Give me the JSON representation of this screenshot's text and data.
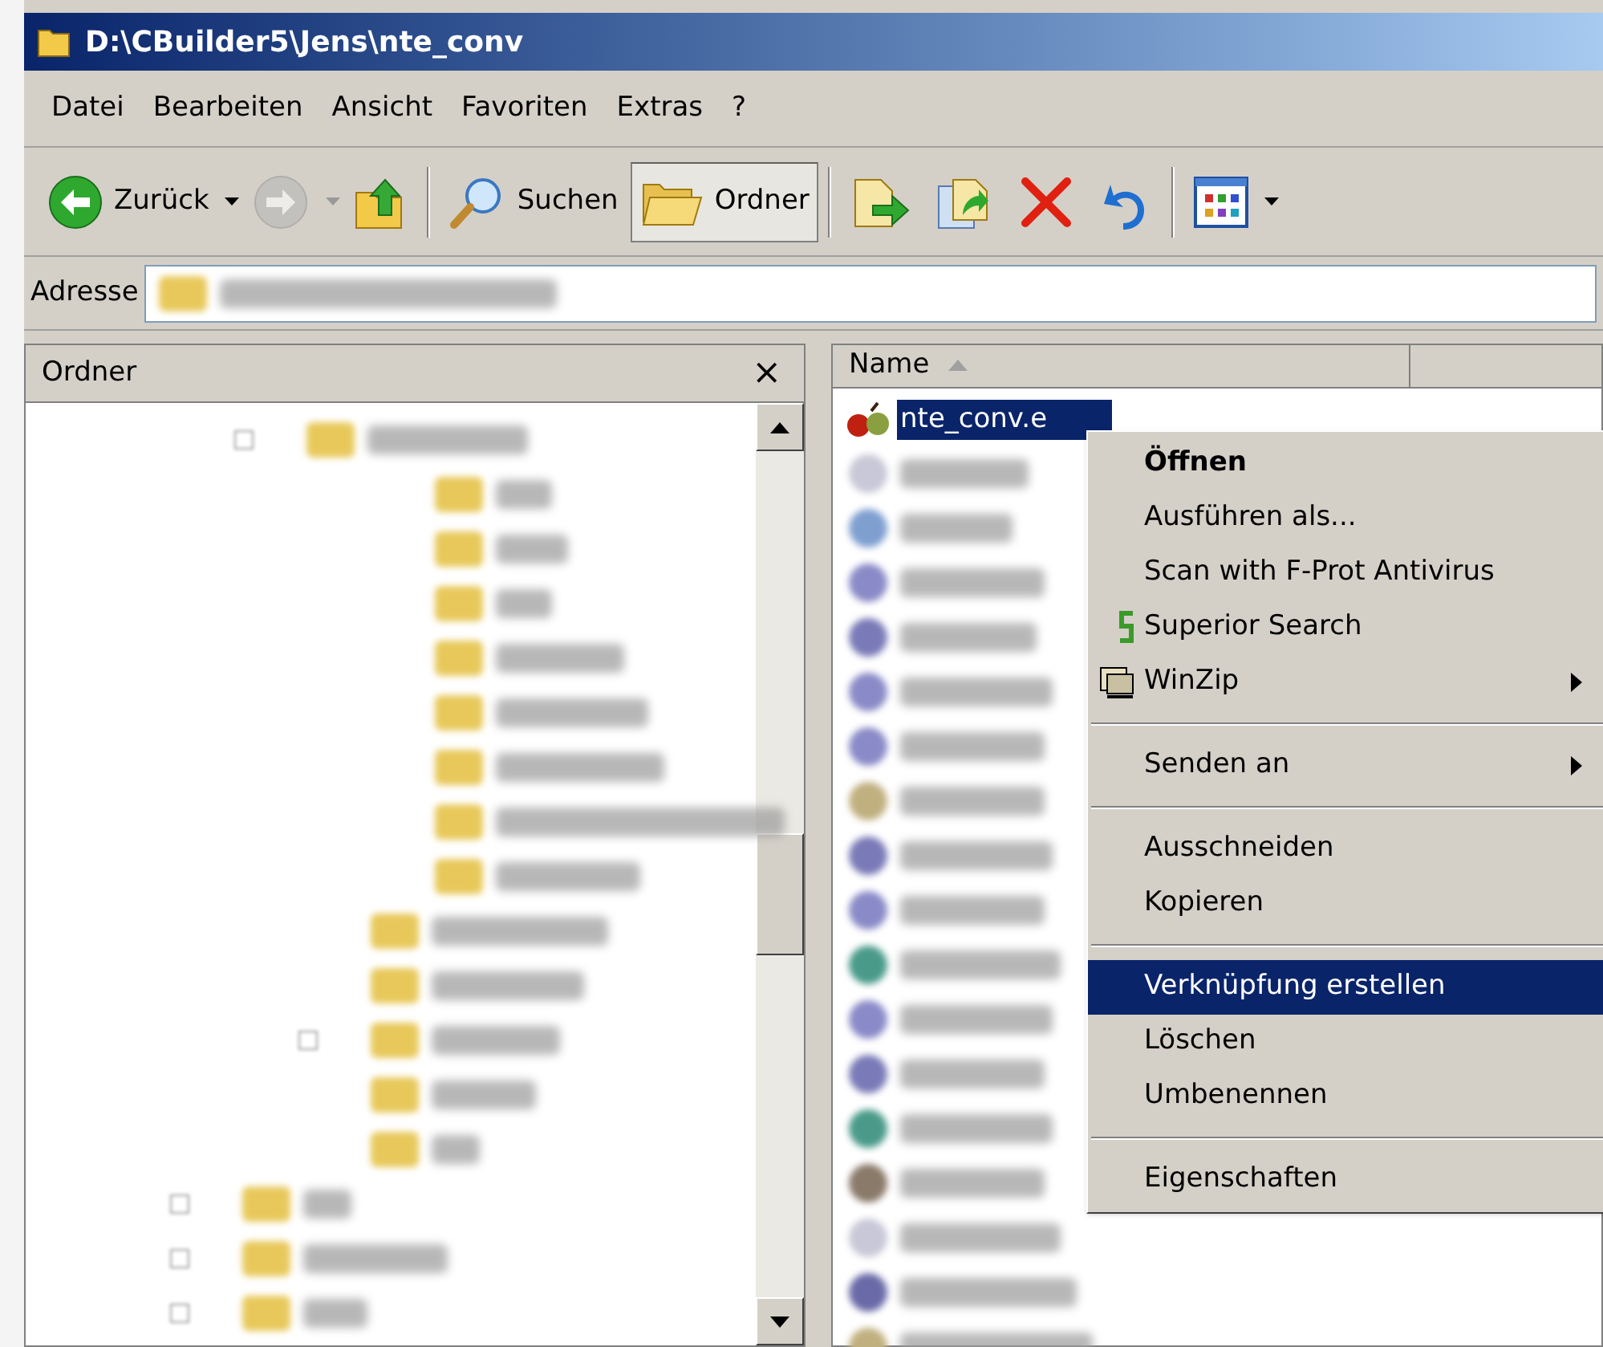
{
  "window": {
    "title": "D:\\CBuilder5\\Jens\\nte_conv"
  },
  "menu_bar": [
    "Datei",
    "Bearbeiten",
    "Ansicht",
    "Favoriten",
    "Extras",
    "?"
  ],
  "toolbar": [
    {
      "kind": "button",
      "label": "Zurück",
      "dropdown": true,
      "disabled": false,
      "selected": false
    },
    {
      "kind": "button",
      "dropdown": true,
      "disabled": true,
      "selected": false
    },
    {
      "kind": "button",
      "dropdown": false,
      "disabled": false,
      "selected": false
    },
    {
      "kind": "separator"
    },
    {
      "kind": "button",
      "label": "Suchen",
      "dropdown": false,
      "disabled": false,
      "selected": false
    },
    {
      "kind": "button",
      "label": "Ordner",
      "dropdown": false,
      "disabled": false,
      "selected": true
    },
    {
      "kind": "separator"
    },
    {
      "kind": "button",
      "dropdown": false,
      "disabled": false,
      "selected": false
    },
    {
      "kind": "button",
      "dropdown": false,
      "disabled": false,
      "selected": false
    },
    {
      "kind": "button",
      "dropdown": false,
      "disabled": false,
      "selected": false
    },
    {
      "kind": "button",
      "dropdown": false,
      "disabled": false,
      "selected": false
    },
    {
      "kind": "separator"
    },
    {
      "kind": "button",
      "dropdown": true,
      "disabled": false,
      "selected": false
    }
  ],
  "address_bar": {
    "label": "Adresse"
  },
  "folder_pane": {
    "title": "Ordner",
    "close": "×"
  },
  "file_list": {
    "columns": [
      {
        "label": "Name",
        "sorted": true
      }
    ],
    "rows": [
      {
        "name": "nte_conv.e",
        "selected": true
      }
    ]
  },
  "context_menu": [
    {
      "kind": "item",
      "label": "Öffnen",
      "default": true,
      "submenu": false,
      "selected": false
    },
    {
      "kind": "item",
      "label": "Ausführen als...",
      "default": false,
      "submenu": false,
      "selected": false
    },
    {
      "kind": "item",
      "label": "Scan with F-Prot Antivirus",
      "default": false,
      "submenu": false,
      "selected": false
    },
    {
      "kind": "item",
      "label": "Superior Search",
      "default": false,
      "submenu": false,
      "selected": false
    },
    {
      "kind": "item",
      "label": "WinZip",
      "default": false,
      "submenu": true,
      "selected": false
    },
    {
      "kind": "separator"
    },
    {
      "kind": "item",
      "label": "Senden an",
      "default": false,
      "submenu": true,
      "selected": false
    },
    {
      "kind": "separator"
    },
    {
      "kind": "item",
      "label": "Ausschneiden",
      "default": false,
      "submenu": false,
      "selected": false
    },
    {
      "kind": "item",
      "label": "Kopieren",
      "default": false,
      "submenu": false,
      "selected": false
    },
    {
      "kind": "separator"
    },
    {
      "kind": "item",
      "label": "Verknüpfung erstellen",
      "default": false,
      "submenu": false,
      "selected": true
    },
    {
      "kind": "item",
      "label": "Löschen",
      "default": false,
      "submenu": false,
      "selected": false
    },
    {
      "kind": "item",
      "label": "Umbenennen",
      "default": false,
      "submenu": false,
      "selected": false
    },
    {
      "kind": "separator"
    },
    {
      "kind": "item",
      "label": "Eigenschaften",
      "default": false,
      "submenu": false,
      "selected": false
    }
  ]
}
